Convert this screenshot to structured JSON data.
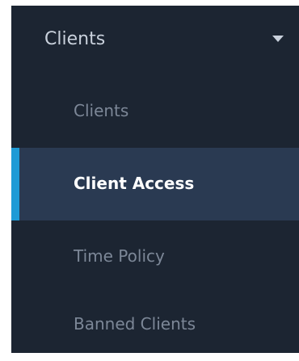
{
  "sidebar": {
    "section": {
      "label": "Clients",
      "icon": "chevron-down-icon",
      "expanded": true
    },
    "items": [
      {
        "label": "Clients",
        "active": false
      },
      {
        "label": "Client Access",
        "active": true
      },
      {
        "label": "Time Policy",
        "active": false
      },
      {
        "label": "Banned Clients",
        "active": false
      }
    ]
  },
  "colors": {
    "background": "#1c2532",
    "active_background": "#2a3a52",
    "active_indicator": "#1f9bd6",
    "text_active": "#ffffff",
    "text_inactive": "#7c8797",
    "section_text": "#c9d1dc"
  }
}
